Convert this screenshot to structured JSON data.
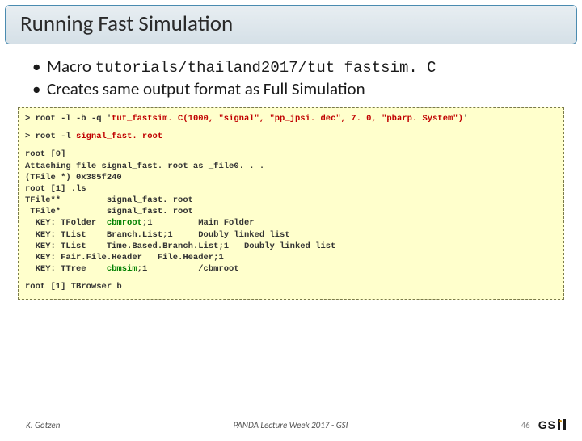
{
  "title": "Running Fast Simulation",
  "bullets": {
    "b1_prefix": "Macro ",
    "b1_code": "tutorials/thailand2017/tut_fastsim. C",
    "b2": "Creates same output format as Full Simulation"
  },
  "terminal": {
    "line1_a": "> root -l -b -q '",
    "line1_b": "tut_fastsim. C(1000, \"signal\", \"pp_jpsi. dec\", 7. 0, \"pbarp. System\")",
    "line1_c": "'",
    "line2_a": "> root -l ",
    "line2_b": "signal_fast. root",
    "block_a": "root [0]\nAttaching file signal_fast. root as _file0. . .\n(TFile *) 0x385f240\nroot [1] .ls\nTFile**         signal_fast. root\n TFile*         signal_fast. root\n  KEY: TFolder  ",
    "block_b": "cbmroot",
    "block_c": ";1         Main Folder\n  KEY: TList    Branch.List;1     Doubly linked list\n  KEY: TList    Time.Based.Branch.List;1   Doubly linked list\n  KEY: Fair.File.Header   File.Header;1\n  KEY: TTree    ",
    "block_d": "cbmsim",
    "block_e": ";1          /cbmroot",
    "line_last": "root [1] TBrowser b"
  },
  "footer": {
    "author": "K. Götzen",
    "center": "PANDA Lecture Week 2017 - GSI",
    "page": "46",
    "logo": "GS"
  }
}
